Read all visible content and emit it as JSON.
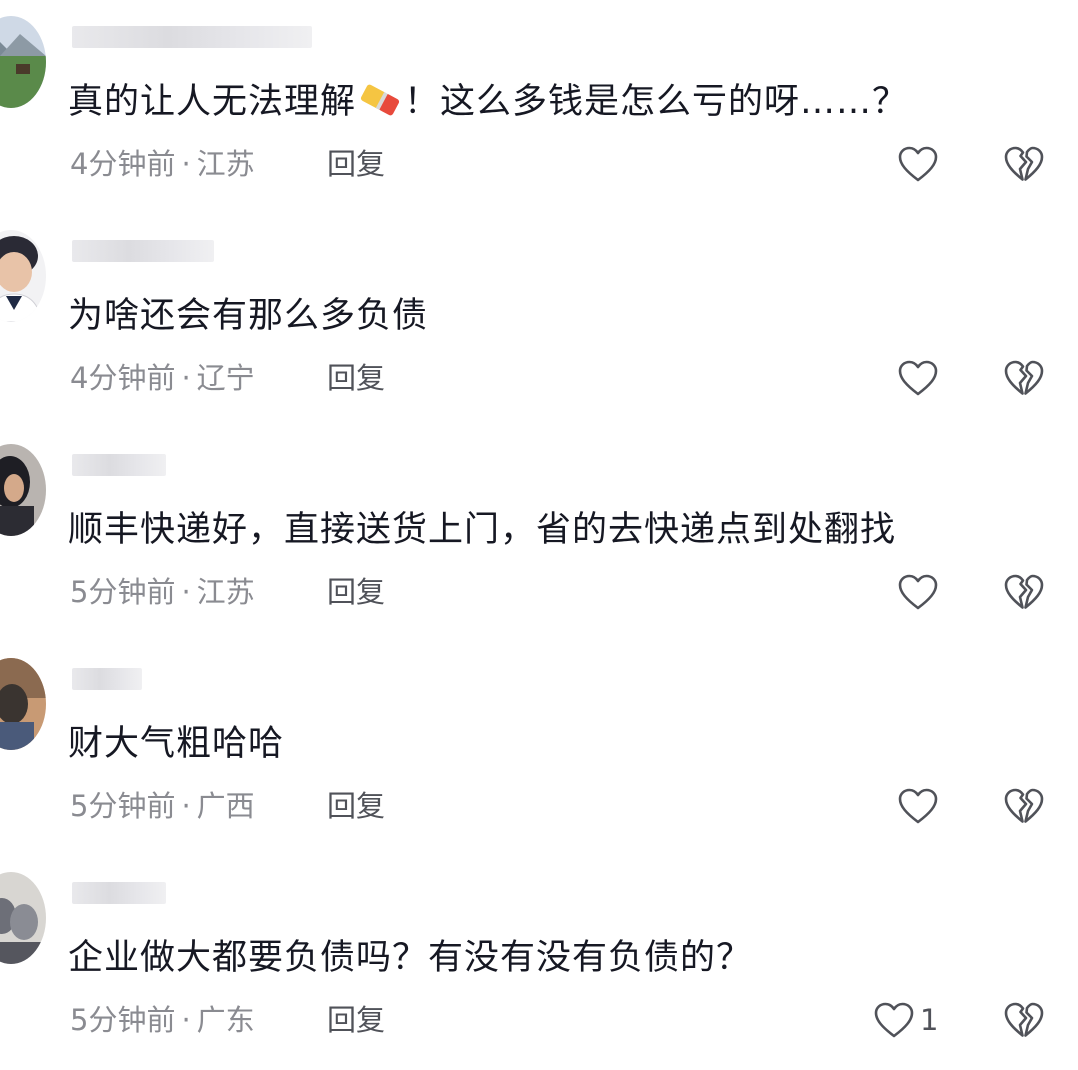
{
  "comments": [
    {
      "text_before": "真的让人无法理解",
      "emoji": "eraser-emoji",
      "text_after": "！这么多钱是怎么亏的呀……？",
      "time": "4分钟前",
      "location": "江苏",
      "reply_label": "回复",
      "like_count": "",
      "avatar_colors": [
        "#5a8a4a",
        "#cfd9e6"
      ]
    },
    {
      "text_before": "为啥还会有那么多负债",
      "emoji": "",
      "text_after": "",
      "time": "4分钟前",
      "location": "辽宁",
      "reply_label": "回复",
      "like_count": "",
      "avatar_colors": [
        "#e8c3a8",
        "#2a2a35"
      ]
    },
    {
      "text_before": "顺丰快递好，直接送货上门，省的去快递点到处翻找",
      "emoji": "",
      "text_after": "",
      "time": "5分钟前",
      "location": "江苏",
      "reply_label": "回复",
      "like_count": "",
      "avatar_colors": [
        "#1e1e24",
        "#b9b4b0"
      ]
    },
    {
      "text_before": "财大气粗哈哈",
      "emoji": "",
      "text_after": "",
      "time": "5分钟前",
      "location": "广西",
      "reply_label": "回复",
      "like_count": "",
      "avatar_colors": [
        "#3a3430",
        "#c89a74"
      ]
    },
    {
      "text_before": "企业做大都要负债吗？有没有没有负债的？",
      "emoji": "",
      "text_after": "",
      "time": "5分钟前",
      "location": "广东",
      "reply_label": "回复",
      "like_count": "1",
      "avatar_colors": [
        "#6d6f78",
        "#d8d6d2"
      ]
    }
  ],
  "colors": {
    "text": "#161823",
    "meta": "#8a8b91",
    "icon": "#505259"
  },
  "icons": {
    "like": "heart-outline-icon",
    "dislike": "broken-heart-icon"
  }
}
